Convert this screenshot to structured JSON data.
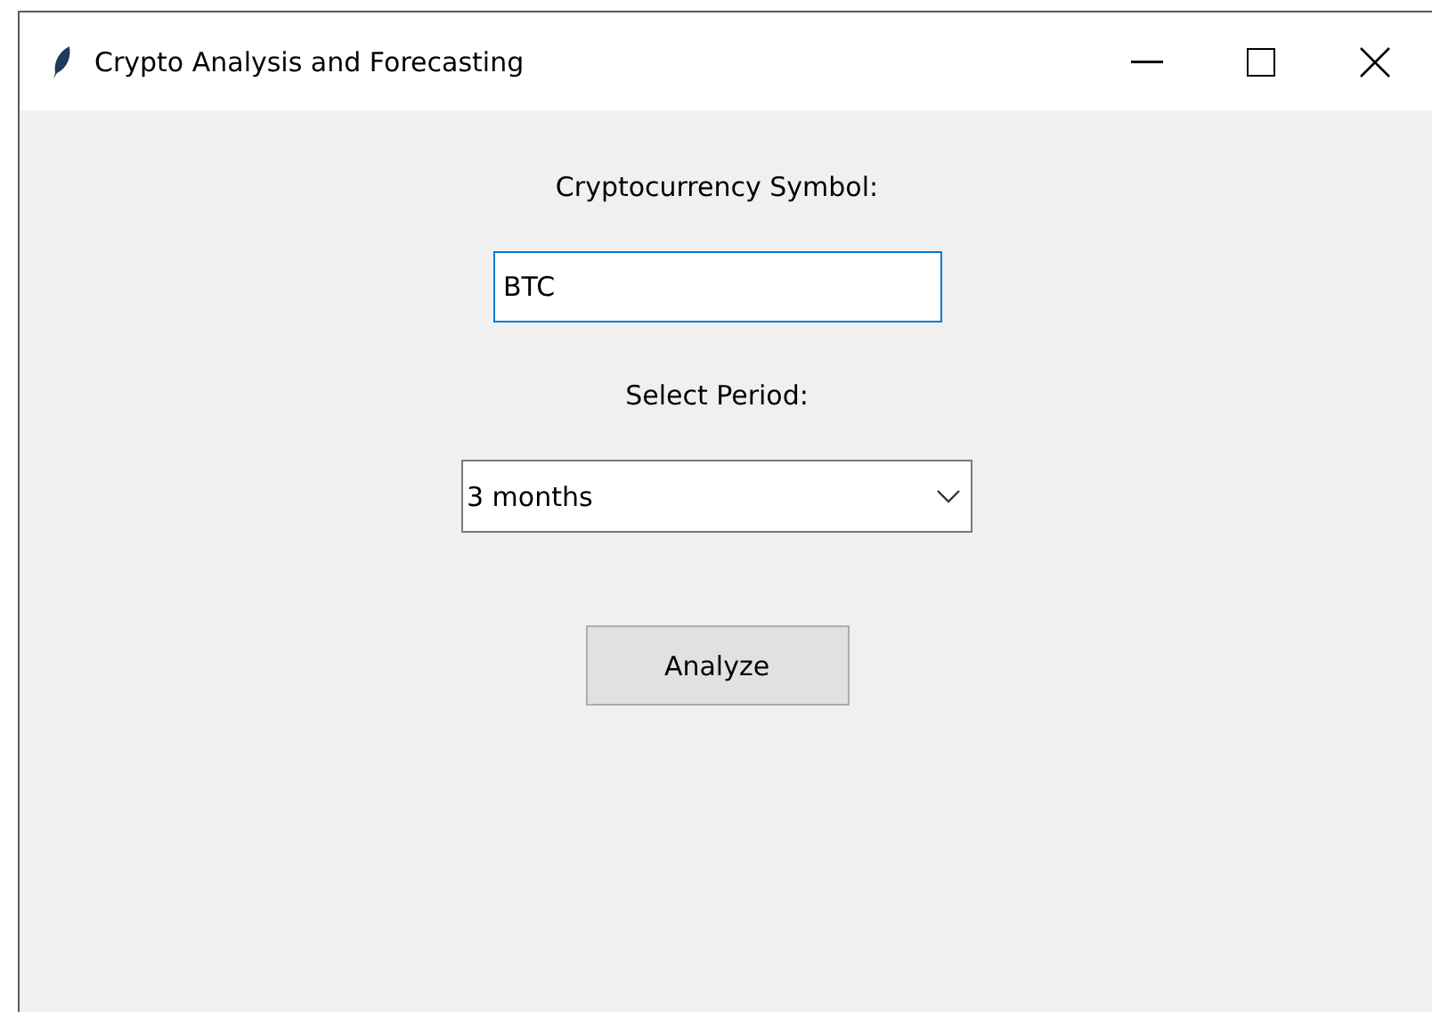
{
  "window": {
    "title": "Crypto Analysis and Forecasting"
  },
  "symbol": {
    "label": "Cryptocurrency Symbol:",
    "value": "BTC",
    "focused": true
  },
  "period": {
    "label": "Select Period:",
    "value": "3 months"
  },
  "button": {
    "label": "Analyze"
  }
}
